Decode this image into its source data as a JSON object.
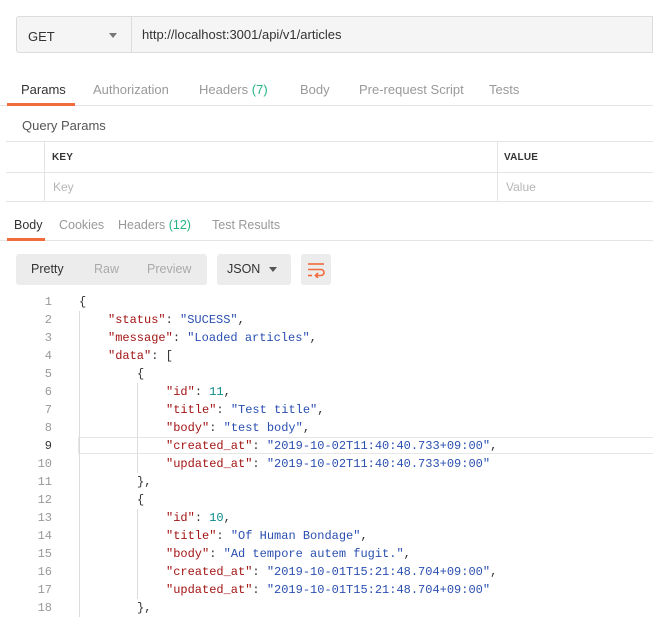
{
  "request": {
    "method": "GET",
    "url": "http://localhost:3001/api/v1/articles"
  },
  "request_tabs": [
    {
      "label": "Params"
    },
    {
      "label": "Authorization"
    },
    {
      "label": "Headers",
      "count": "(7)"
    },
    {
      "label": "Body"
    },
    {
      "label": "Pre-request Script"
    },
    {
      "label": "Tests"
    }
  ],
  "query_params": {
    "title": "Query Params",
    "key_header": "KEY",
    "value_header": "VALUE",
    "key_placeholder": "Key",
    "value_placeholder": "Value"
  },
  "response_tabs": [
    {
      "label": "Body"
    },
    {
      "label": "Cookies"
    },
    {
      "label": "Headers",
      "count": "(12)"
    },
    {
      "label": "Test Results"
    }
  ],
  "view_modes": [
    "Pretty",
    "Raw",
    "Preview"
  ],
  "format": "JSON",
  "colors": {
    "accent": "#f26b3a",
    "count": "#26b47f",
    "key": "#a31515",
    "string": "#2a4fb0",
    "number": "#0b8a8a"
  },
  "icons": {
    "wrap": "wrap-lines-icon",
    "caret": "chevron-down-icon"
  },
  "active_line": 9,
  "code_lines": [
    {
      "n": "1",
      "indent": 0,
      "parts": [
        [
          "p",
          "{"
        ]
      ]
    },
    {
      "n": "2",
      "indent": 1,
      "parts": [
        [
          "k",
          "\"status\""
        ],
        [
          "p",
          ": "
        ],
        [
          "s",
          "\"SUCESS\""
        ],
        [
          "p",
          ","
        ]
      ]
    },
    {
      "n": "3",
      "indent": 1,
      "parts": [
        [
          "k",
          "\"message\""
        ],
        [
          "p",
          ": "
        ],
        [
          "s",
          "\"Loaded articles\""
        ],
        [
          "p",
          ","
        ]
      ]
    },
    {
      "n": "4",
      "indent": 1,
      "parts": [
        [
          "k",
          "\"data\""
        ],
        [
          "p",
          ": ["
        ]
      ]
    },
    {
      "n": "5",
      "indent": 2,
      "parts": [
        [
          "p",
          "{"
        ]
      ]
    },
    {
      "n": "6",
      "indent": 3,
      "parts": [
        [
          "k",
          "\"id\""
        ],
        [
          "p",
          ": "
        ],
        [
          "n",
          "11"
        ],
        [
          "p",
          ","
        ]
      ]
    },
    {
      "n": "7",
      "indent": 3,
      "parts": [
        [
          "k",
          "\"title\""
        ],
        [
          "p",
          ": "
        ],
        [
          "s",
          "\"Test title\""
        ],
        [
          "p",
          ","
        ]
      ]
    },
    {
      "n": "8",
      "indent": 3,
      "parts": [
        [
          "k",
          "\"body\""
        ],
        [
          "p",
          ": "
        ],
        [
          "s",
          "\"test body\""
        ],
        [
          "p",
          ","
        ]
      ]
    },
    {
      "n": "9",
      "indent": 3,
      "parts": [
        [
          "k",
          "\"created_at\""
        ],
        [
          "p",
          ": "
        ],
        [
          "s",
          "\"2019-10-02T11:40:40.733+09:00\""
        ],
        [
          "p",
          ","
        ]
      ]
    },
    {
      "n": "10",
      "indent": 3,
      "parts": [
        [
          "k",
          "\"updated_at\""
        ],
        [
          "p",
          ": "
        ],
        [
          "s",
          "\"2019-10-02T11:40:40.733+09:00\""
        ]
      ]
    },
    {
      "n": "11",
      "indent": 2,
      "parts": [
        [
          "p",
          "},"
        ]
      ]
    },
    {
      "n": "12",
      "indent": 2,
      "parts": [
        [
          "p",
          "{"
        ]
      ]
    },
    {
      "n": "13",
      "indent": 3,
      "parts": [
        [
          "k",
          "\"id\""
        ],
        [
          "p",
          ": "
        ],
        [
          "n",
          "10"
        ],
        [
          "p",
          ","
        ]
      ]
    },
    {
      "n": "14",
      "indent": 3,
      "parts": [
        [
          "k",
          "\"title\""
        ],
        [
          "p",
          ": "
        ],
        [
          "s",
          "\"Of Human Bondage\""
        ],
        [
          "p",
          ","
        ]
      ]
    },
    {
      "n": "15",
      "indent": 3,
      "parts": [
        [
          "k",
          "\"body\""
        ],
        [
          "p",
          ": "
        ],
        [
          "s",
          "\"Ad tempore autem fugit.\""
        ],
        [
          "p",
          ","
        ]
      ]
    },
    {
      "n": "16",
      "indent": 3,
      "parts": [
        [
          "k",
          "\"created_at\""
        ],
        [
          "p",
          ": "
        ],
        [
          "s",
          "\"2019-10-01T15:21:48.704+09:00\""
        ],
        [
          "p",
          ","
        ]
      ]
    },
    {
      "n": "17",
      "indent": 3,
      "parts": [
        [
          "k",
          "\"updated_at\""
        ],
        [
          "p",
          ": "
        ],
        [
          "s",
          "\"2019-10-01T15:21:48.704+09:00\""
        ]
      ]
    },
    {
      "n": "18",
      "indent": 2,
      "parts": [
        [
          "p",
          "},"
        ]
      ]
    }
  ]
}
